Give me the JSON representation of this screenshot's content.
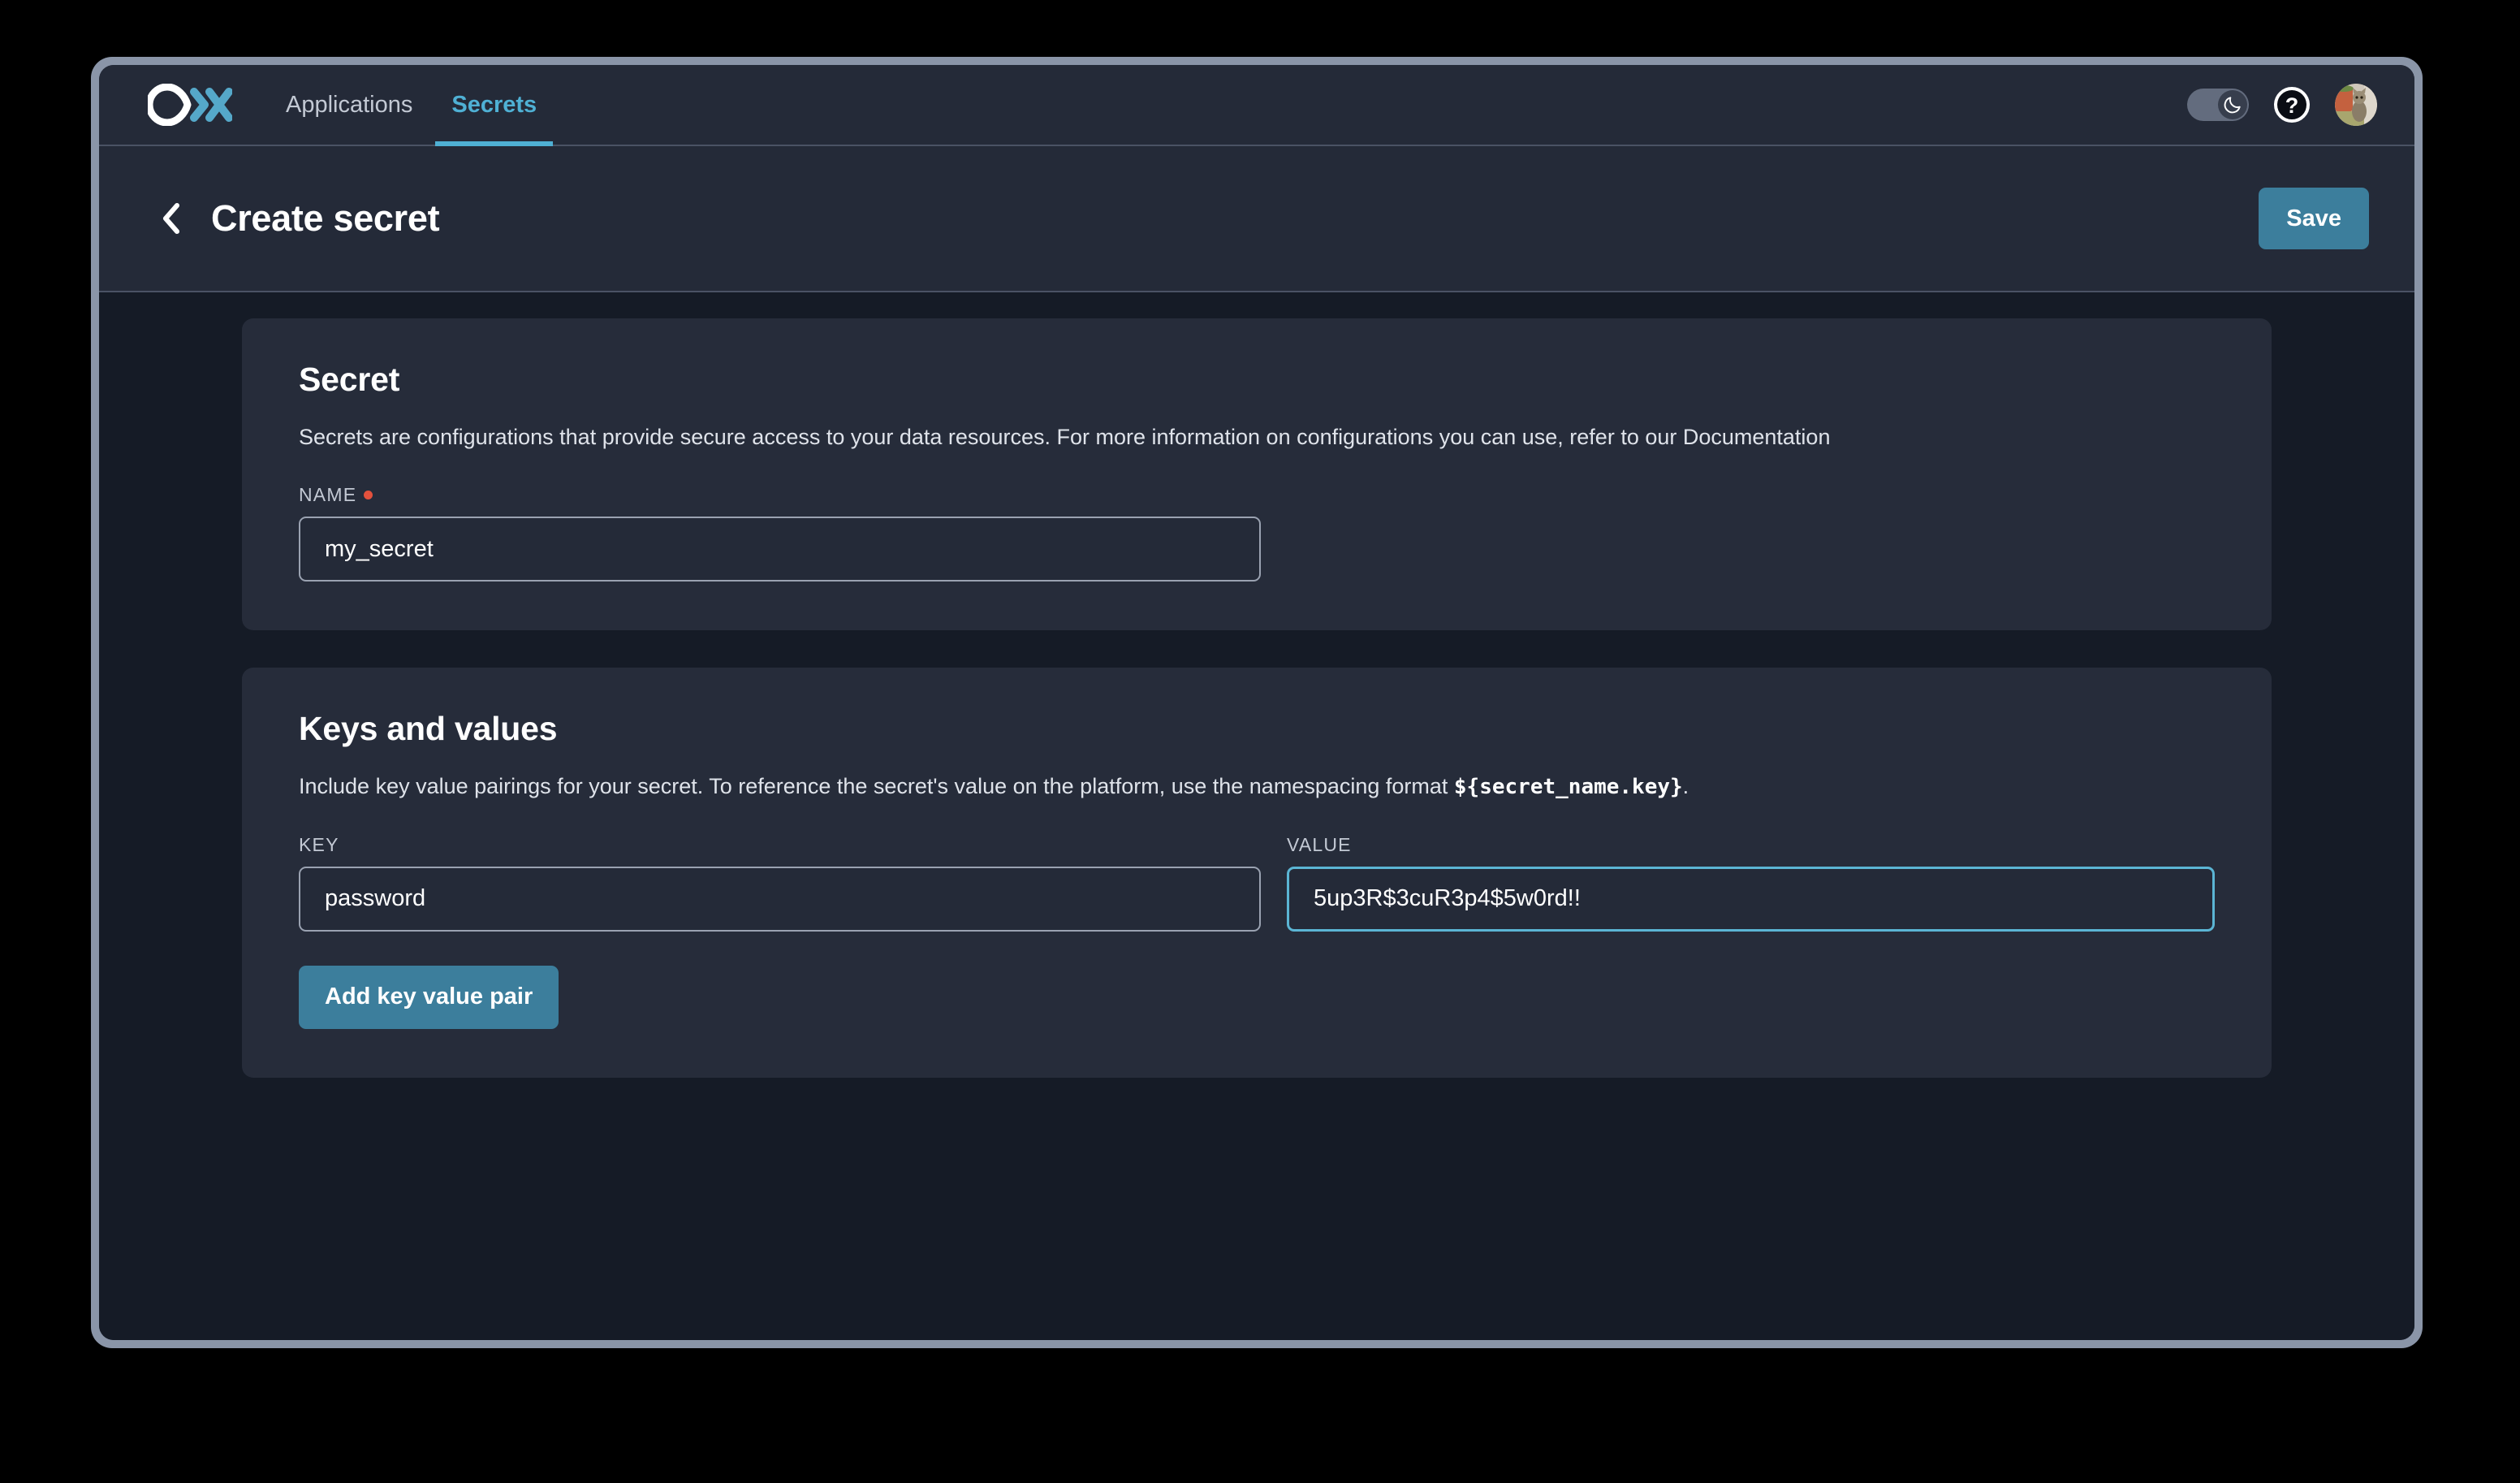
{
  "nav": {
    "logo_name": "ox-logo",
    "tabs": [
      {
        "label": "Applications",
        "active": false
      },
      {
        "label": "Secrets",
        "active": true
      }
    ],
    "theme_toggle": {
      "name": "dark-mode-toggle",
      "state": "on",
      "icon": "moon-icon"
    },
    "help_icon": "help-circle-icon",
    "avatar": "user-avatar-cat"
  },
  "header": {
    "back_icon": "chevron-left-icon",
    "title": "Create secret",
    "save_label": "Save"
  },
  "secret_card": {
    "title": "Secret",
    "description": "Secrets are configurations that provide secure access to your data resources. For more information on configurations you can use, refer to our Documentation",
    "name_label": "NAME",
    "name_required": true,
    "name_value": "my_secret",
    "name_placeholder": "Name"
  },
  "keys_card": {
    "title": "Keys and values",
    "description_part1": "Include key value pairings for your secret. To reference the secret's value on the platform, use the namespacing format ",
    "description_code": "${secret_name.key}",
    "description_part2": ".",
    "key_label": "KEY",
    "value_label": "VALUE",
    "key_value": "password",
    "key_placeholder": "Key",
    "value_value": "5up3R$3cuR3p4$5w0rd!!",
    "value_placeholder": "Value",
    "value_focused": true,
    "add_button_label": "Add key value pair"
  },
  "colors": {
    "accent": "#4fb0d4",
    "button": "#3c7e9c",
    "page_bg": "#151b26",
    "card_bg": "#262c3a",
    "bar_bg": "#242a38",
    "required": "#e3513d",
    "frame": "#8a95a8"
  }
}
